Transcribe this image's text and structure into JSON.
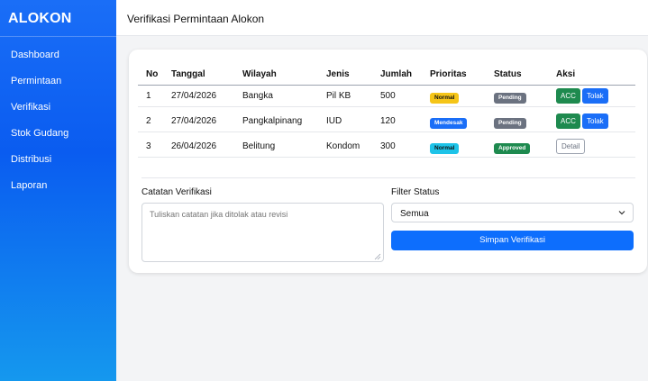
{
  "sidebar": {
    "brand": "ALOKON",
    "items": [
      {
        "label": "Dashboard"
      },
      {
        "label": "Permintaan"
      },
      {
        "label": "Verifikasi"
      },
      {
        "label": "Stok Gudang"
      },
      {
        "label": "Distribusi"
      },
      {
        "label": "Laporan"
      }
    ]
  },
  "header": {
    "title": "Verifikasi Permintaan Alokon"
  },
  "table": {
    "columns": [
      "No",
      "Tanggal",
      "Wilayah",
      "Jenis",
      "Jumlah",
      "Prioritas",
      "Status",
      "Aksi"
    ],
    "rows": [
      {
        "no": "1",
        "tanggal": "27/04/2026",
        "wilayah": "Bangka",
        "jenis": "Pil KB",
        "jumlah": "500",
        "prioritas": "Normal",
        "status": "Pending",
        "acc": "ACC",
        "tolak": "Tolak"
      },
      {
        "no": "2",
        "tanggal": "27/04/2026",
        "wilayah": "Pangkalpinang",
        "jenis": "IUD",
        "jumlah": "120",
        "prioritas": "Mendesak",
        "status": "Pending",
        "acc": "ACC",
        "tolak": "Tolak"
      },
      {
        "no": "3",
        "tanggal": "26/04/2026",
        "wilayah": "Belitung",
        "jenis": "Kondom",
        "jumlah": "300",
        "prioritas": "Normal",
        "status": "Approved",
        "detail": "Detail"
      }
    ]
  },
  "form": {
    "notes_label": "Catatan Verifikasi",
    "notes_placeholder": "Tuliskan catatan jika ditolak atau revisi",
    "filter_label": "Filter Status",
    "filter_value": "Semua",
    "save_label": "Simpan Verifikasi"
  },
  "colors": {
    "primary": "#0d6efd",
    "success": "#1e8a4f",
    "warning": "#f5c518",
    "info": "#1ec3e8",
    "secondary": "#6b7280"
  },
  "icons": {
    "select_chevron": "chevron-down-icon",
    "resize_grip": "resize-grip-icon"
  }
}
